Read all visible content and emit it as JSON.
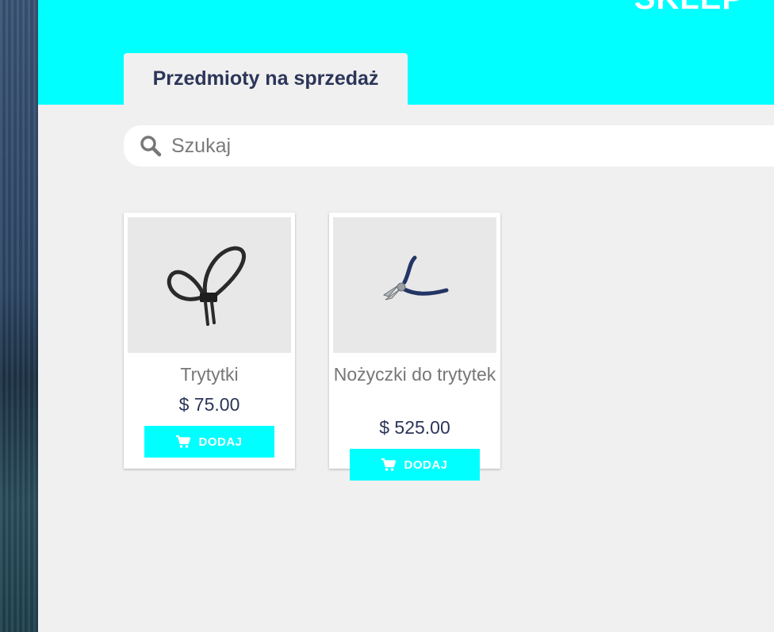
{
  "header": {
    "title": "SKLEP"
  },
  "tab": {
    "label": "Przedmioty na sprzedaż"
  },
  "search": {
    "placeholder": "Szukaj",
    "value": ""
  },
  "products": [
    {
      "name": "Trytytki",
      "price": "$ 75.00",
      "button_label": "DODAJ",
      "image_icon": "zip-tie-icon"
    },
    {
      "name": "Nożyczki do trytytek",
      "price": "$ 525.00",
      "button_label": "DODAJ",
      "image_icon": "pliers-icon"
    }
  ],
  "colors": {
    "accent": "#00ffff",
    "text_dark": "#2c3559",
    "text_muted": "#777777",
    "panel_bg": "#f0f0f0"
  }
}
